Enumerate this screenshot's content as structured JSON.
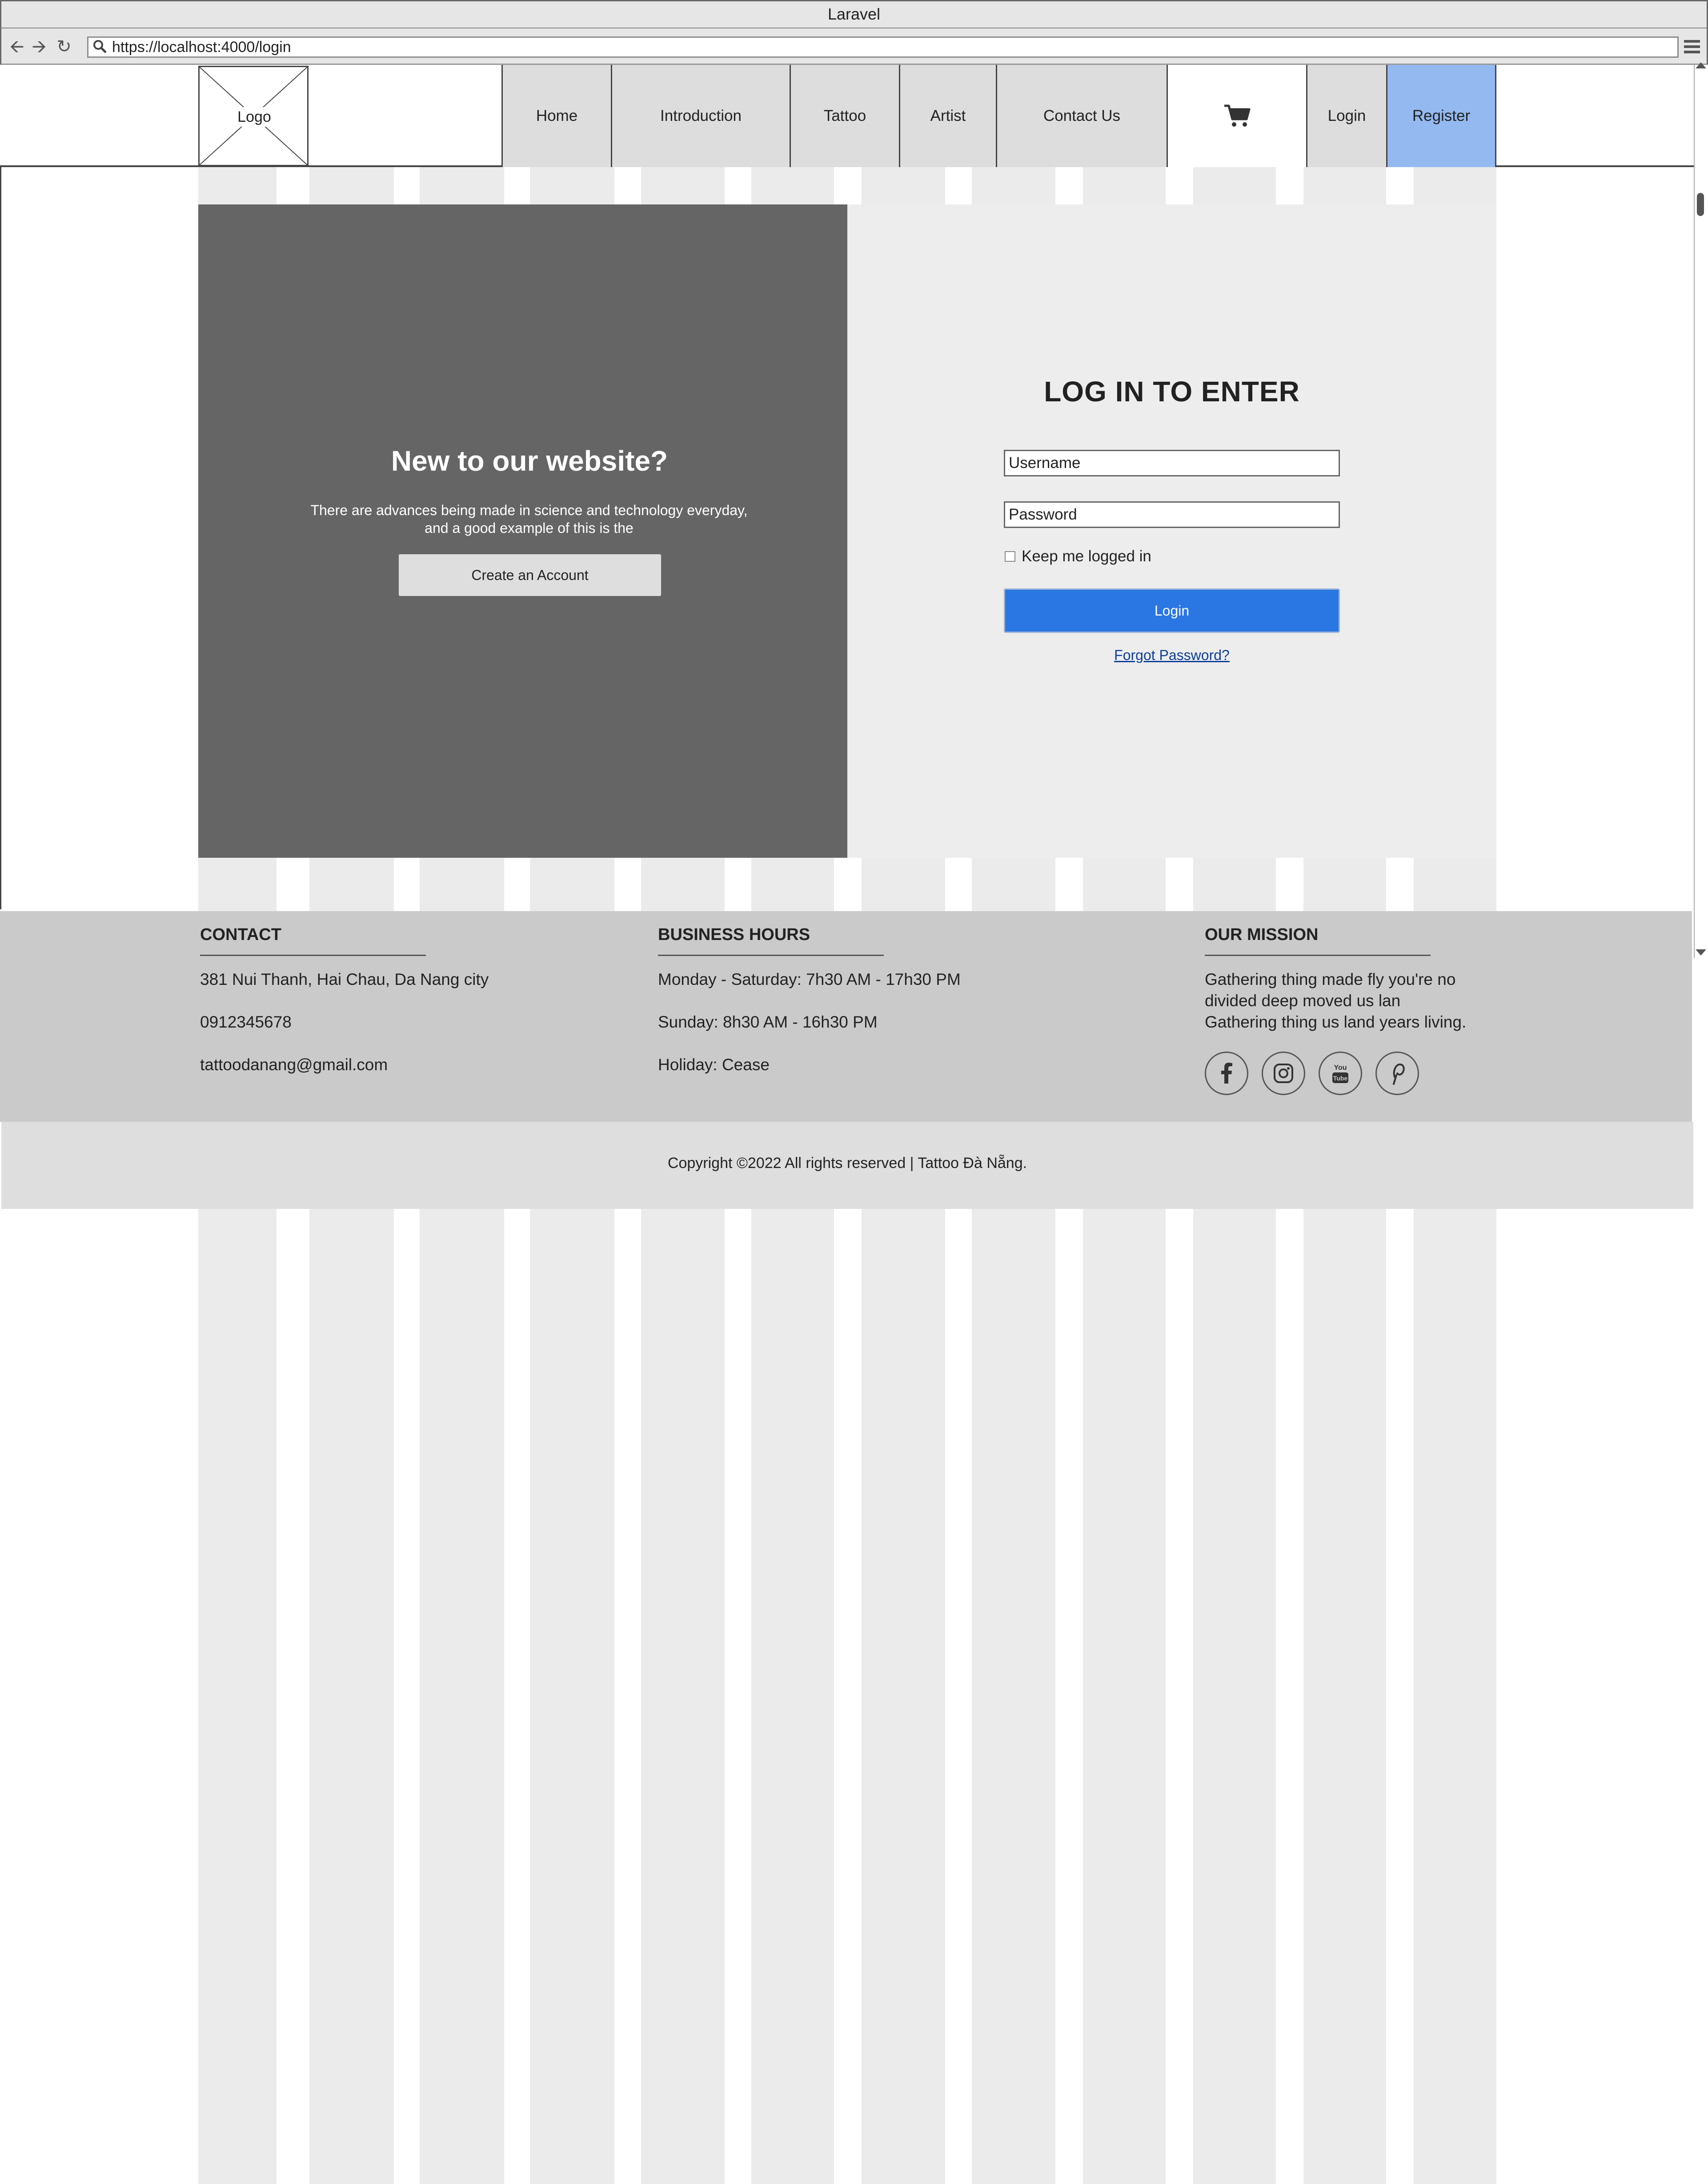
{
  "browser": {
    "window_title": "Laravel",
    "url": "https://localhost:4000/login"
  },
  "header": {
    "logo_label": "Logo",
    "nav": [
      {
        "label": "Home"
      },
      {
        "label": "Introduction"
      },
      {
        "label": "Tattoo"
      },
      {
        "label": "Artist"
      },
      {
        "label": "Contact Us"
      }
    ],
    "cart_icon": "shopping-cart-icon",
    "login_label": "Login",
    "register_label": "Register",
    "register_color": "#93b9f0"
  },
  "signup_panel": {
    "title": "New to our website?",
    "description": "There are advances being made in science and technology everyday, and a good example of this is the",
    "button_label": "Create an Account"
  },
  "login_panel": {
    "title": "LOG IN TO ENTER",
    "username_placeholder": "Username",
    "password_placeholder": "Password",
    "keep_logged_in_label": "Keep me logged in",
    "keep_logged_in_checked": false,
    "submit_label": "Login",
    "submit_color": "#2a76e3",
    "forgot_label": "Forgot Password?"
  },
  "footer": {
    "contact": {
      "heading": "CONTACT",
      "lines": [
        "381 Nui Thanh, Hai Chau, Da Nang city",
        "0912345678",
        "tattoodanang@gmail.com"
      ]
    },
    "hours": {
      "heading": "BUSINESS HOURS",
      "lines": [
        "Monday - Saturday: 7h30 AM - 17h30 PM",
        "Sunday: 8h30 AM - 16h30 PM",
        "Holiday: Cease"
      ]
    },
    "mission": {
      "heading": "OUR MISSION",
      "lines": [
        "Gathering thing made fly you're no",
        "divided deep moved us lan",
        "Gathering thing us land years living."
      ]
    },
    "social": [
      "facebook-icon",
      "instagram-icon",
      "youtube-icon",
      "pinterest-icon"
    ],
    "copyright": "Copyright ©2022 All rights reserved | Tattoo Đà Nẵng."
  }
}
